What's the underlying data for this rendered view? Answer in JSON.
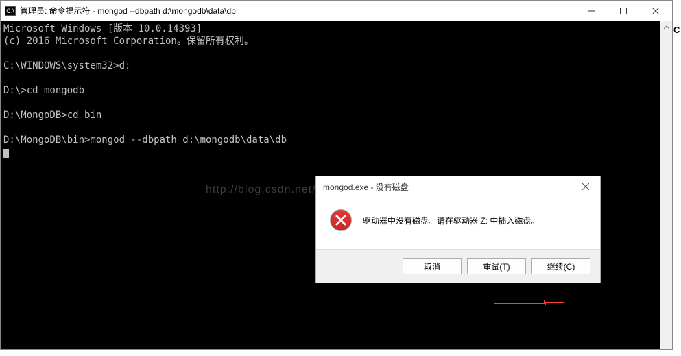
{
  "window": {
    "title": "管理员: 命令提示符 - mongod  --dbpath d:\\mongodb\\data\\db",
    "icon_label": "C:\\"
  },
  "terminal": {
    "line1": "Microsoft Windows [版本 10.0.14393]",
    "line2": "(c) 2016 Microsoft Corporation。保留所有权利。",
    "line3": "",
    "line4": "C:\\WINDOWS\\system32>d:",
    "line5": "",
    "line6": "D:\\>cd mongodb",
    "line7": "",
    "line8": "D:\\MongoDB>cd bin",
    "line9": "",
    "line10": "D:\\MongoDB\\bin>mongod --dbpath d:\\mongodb\\data\\db"
  },
  "watermark": "http://blog.csdn.net/Clara_G",
  "dialog": {
    "title": "mongod.exe - 没有磁盘",
    "message": "驱动器中没有磁盘。请在驱动器 Z: 中插入磁盘。",
    "buttons": {
      "cancel": "取消",
      "retry": "重试(T)",
      "continue": "继续(C)"
    }
  },
  "side_char": "C"
}
